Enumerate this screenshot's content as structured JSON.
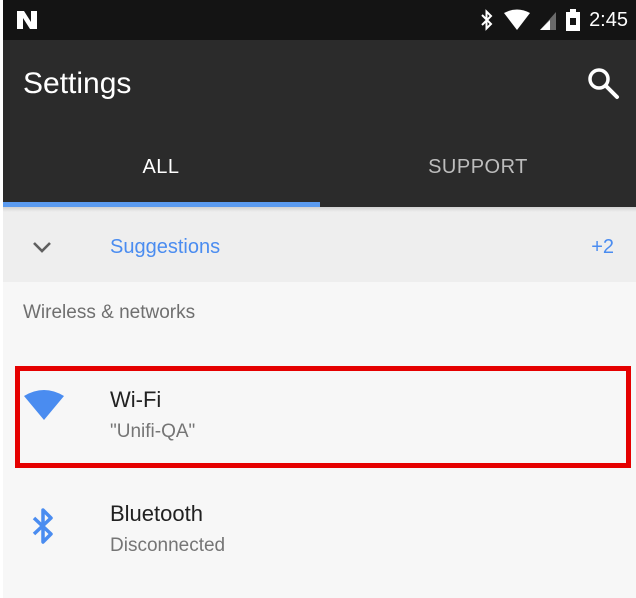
{
  "status_bar": {
    "time": "2:45",
    "icons": [
      "notification-n-icon",
      "bluetooth-icon",
      "wifi-signal-icon",
      "cell-signal-icon",
      "battery-icon"
    ]
  },
  "toolbar": {
    "title": "Settings",
    "search_icon": "search-icon"
  },
  "tabs": [
    {
      "label": "ALL",
      "selected": true
    },
    {
      "label": "SUPPORT",
      "selected": false
    }
  ],
  "suggestions": {
    "label": "Suggestions",
    "count": "+2",
    "icon": "chevron-down-icon"
  },
  "section": {
    "header": "Wireless & networks"
  },
  "items": [
    {
      "title": "Wi-Fi",
      "subtitle": "\"Unifi-QA\"",
      "icon": "wifi-icon",
      "highlighted": true
    },
    {
      "title": "Bluetooth",
      "subtitle": "Disconnected",
      "icon": "bluetooth-icon",
      "highlighted": false
    }
  ],
  "colors": {
    "accent": "#4a8cf0",
    "toolbar": "#2b2b2b",
    "status_bar": "#141414",
    "highlight": "#e50000"
  }
}
